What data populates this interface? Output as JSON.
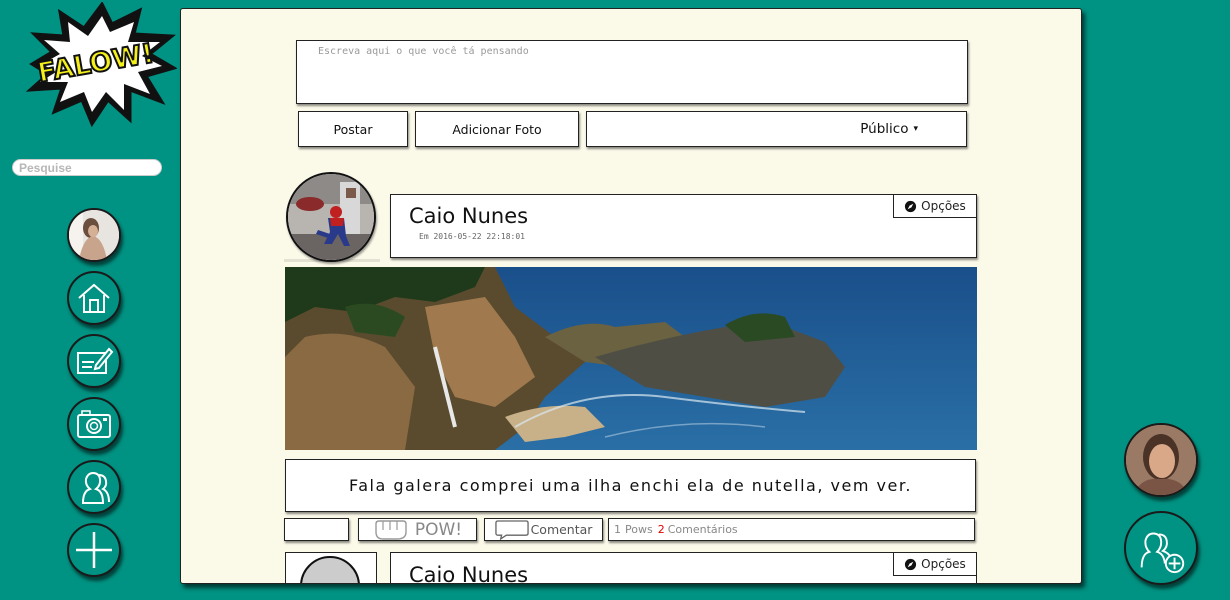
{
  "sidebar": {
    "logo_text": "FALOW!",
    "search_placeholder": "Pesquise",
    "nav_items": [
      {
        "icon": "user-avatar"
      },
      {
        "icon": "home-icon"
      },
      {
        "icon": "write-icon"
      },
      {
        "icon": "camera-icon"
      },
      {
        "icon": "friends-icon"
      },
      {
        "icon": "plus-icon"
      }
    ]
  },
  "composer": {
    "placeholder": "Escreva aqui o que você tá pensando",
    "post_label": "Postar",
    "add_photo_label": "Adicionar Foto",
    "privacy_label": "Público",
    "privacy_caret": "▾"
  },
  "post": {
    "author": "Caio Nunes",
    "date": "Em 2016-05-22 22:18:01",
    "options_label": "Opções",
    "caption": "Fala galera comprei uma ilha enchi ela de nutella, vem ver.",
    "pow_label": "POW!",
    "comment_label": "Comentar",
    "pows_count": "1",
    "pows_label": "Pows",
    "comments_count": "2",
    "comments_label": "Comentários"
  },
  "post2": {
    "author": "Caio Nunes",
    "options_label": "Opções"
  },
  "colors": {
    "background": "#009282",
    "panel": "#fbf9e8",
    "logo_yellow": "#f5ef1a",
    "accent_red": "#e00000"
  }
}
